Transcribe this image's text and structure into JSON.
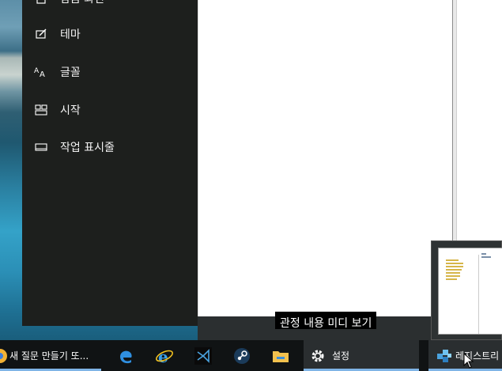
{
  "settings": {
    "nav_items": [
      {
        "label": "잠금 화면",
        "icon": "lock-screen-icon"
      },
      {
        "label": "테마",
        "icon": "theme-brush-icon"
      },
      {
        "label": "글꼴",
        "icon": "font-icon"
      },
      {
        "label": "시작",
        "icon": "start-grid-icon"
      },
      {
        "label": "작업 표시줄",
        "icon": "taskbar-icon"
      }
    ]
  },
  "subtitle": {
    "text": "관정 내용 미디 보기"
  },
  "taskbar": {
    "items": [
      {
        "label": "새 질문 만들기 또...",
        "icon": "chrome-icon"
      },
      {
        "label": "",
        "icon": "edge-icon"
      },
      {
        "label": "",
        "icon": "internet-explorer-icon"
      },
      {
        "label": "",
        "icon": "visual-studio-icon"
      },
      {
        "label": "",
        "icon": "steam-icon"
      },
      {
        "label": "",
        "icon": "file-explorer-icon"
      },
      {
        "label": "설정",
        "icon": "settings-gear-icon"
      },
      {
        "label": "레지스트리",
        "icon": "registry-editor-icon"
      }
    ]
  },
  "colors": {
    "settings_bg": "#1d1f1d",
    "taskbar_bg": "#101314",
    "accent": "#7fb4e6"
  }
}
